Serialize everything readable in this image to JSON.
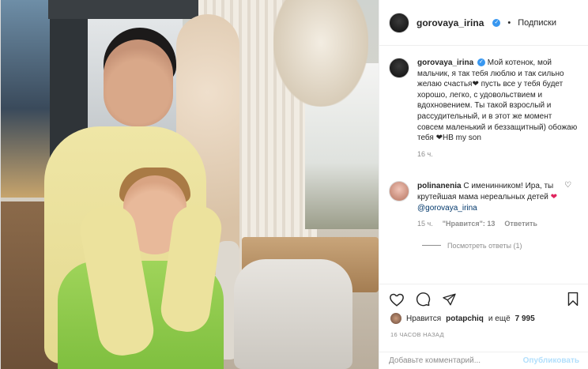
{
  "post": {
    "author": "gorovaya_irina",
    "header_separator": "•",
    "follow_label": "Подписки",
    "caption": "Мой котенок, мой мальчик, я так тебя люблю и так сильно желаю счастья❤ пусть все у тебя будет хорошо, легко, с удовольствием и вдохновением. Ты такой взрослый и рассудительный, и в этот же момент совсем маленький и беззащитный) обожаю тебя ❤НВ my son",
    "caption_time": "16 ч.",
    "comment": {
      "author": "polinanenia",
      "text": "С именинником! Ира, ты крутейшая мама нереальных детей",
      "mention": "@gorovaya_irina",
      "time": "15 ч.",
      "likes": "\"Нравится\": 13",
      "reply_label": "Ответить",
      "view_replies": "Посмотреть ответы (1)"
    },
    "likes_prefix": "Нравится",
    "likes_user": "potapchiq",
    "likes_suffix": "и ещё",
    "likes_count": "7 995",
    "timestamp": "16 ЧАСОВ НАЗАД",
    "comment_input_placeholder": "Добавьте комментарий...",
    "publish_label": "Опубликовать"
  },
  "colors": {
    "link": "#00376b",
    "verified": "#3897f0",
    "publish": "#b2dffc",
    "heart": "#e0245e"
  }
}
